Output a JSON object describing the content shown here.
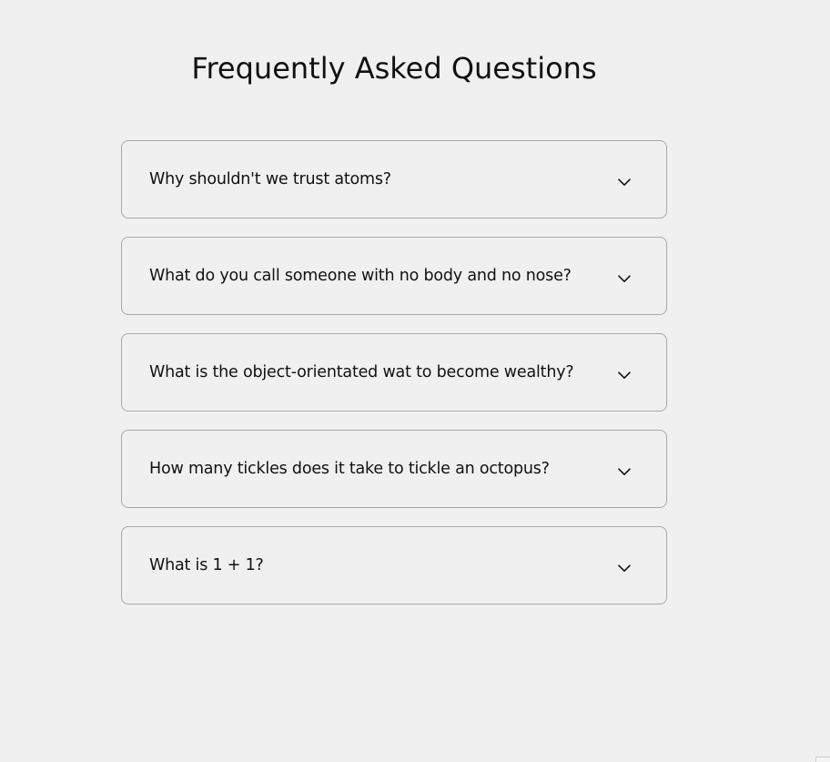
{
  "page": {
    "title": "Frequently Asked Questions"
  },
  "faq": {
    "items": [
      {
        "question": "Why shouldn't we trust atoms?",
        "expanded": false,
        "icon": "chevron-down-icon"
      },
      {
        "question": "What do you call someone with no body and no nose?",
        "expanded": false,
        "icon": "chevron-down-icon"
      },
      {
        "question": "What is the object-orientated wat to become wealthy?",
        "expanded": false,
        "icon": "chevron-down-icon"
      },
      {
        "question": "How many tickles does it take to tickle an octopus?",
        "expanded": false,
        "icon": "chevron-down-icon"
      },
      {
        "question": "What is 1 + 1?",
        "expanded": false,
        "icon": "chevron-down-icon"
      }
    ]
  },
  "colors": {
    "background": "#f0f0f0",
    "border": "#a8a8a8",
    "text": "#111111"
  }
}
